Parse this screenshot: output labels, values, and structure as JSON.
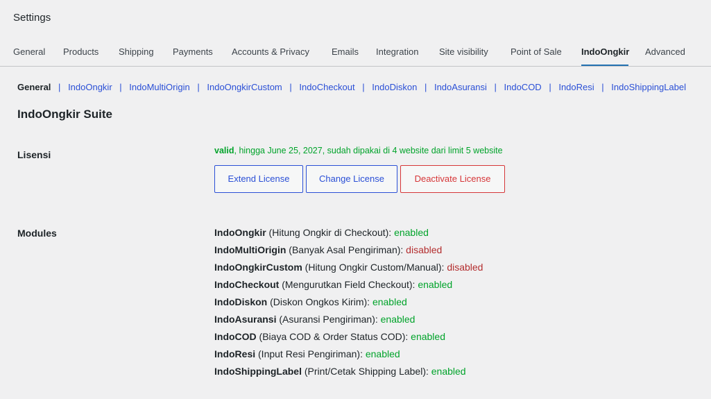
{
  "page": {
    "title": "Settings"
  },
  "tabs": [
    {
      "label": "General"
    },
    {
      "label": "Products"
    },
    {
      "label": "Shipping"
    },
    {
      "label": "Payments"
    },
    {
      "label": "Accounts & Privacy"
    },
    {
      "label": "Emails"
    },
    {
      "label": "Integration"
    },
    {
      "label": "Site visibility"
    },
    {
      "label": "Point of Sale"
    },
    {
      "label": "IndoOngkir",
      "active": true
    },
    {
      "label": "Advanced"
    }
  ],
  "subnav": {
    "separator": "|",
    "items": [
      {
        "label": "General",
        "current": true
      },
      {
        "label": "IndoOngkir"
      },
      {
        "label": "IndoMultiOrigin"
      },
      {
        "label": "IndoOngkirCustom"
      },
      {
        "label": "IndoCheckout"
      },
      {
        "label": "IndoDiskon"
      },
      {
        "label": "IndoAsuransi"
      },
      {
        "label": "IndoCOD"
      },
      {
        "label": "IndoResi"
      },
      {
        "label": "IndoShippingLabel"
      }
    ]
  },
  "section": {
    "title": "IndoOngkir Suite"
  },
  "license": {
    "label": "Lisensi",
    "status_word": "valid",
    "status_detail": ", hingga June 25, 2027, sudah dipakai di 4 website dari limit 5 website",
    "status_color": "#00a32a",
    "buttons": {
      "extend": "Extend License",
      "change": "Change License",
      "deactivate": "Deactivate License"
    }
  },
  "modules": {
    "label": "Modules",
    "items": [
      {
        "name": "IndoOngkir",
        "desc": " (Hitung Ongkir di Checkout): ",
        "status": "enabled"
      },
      {
        "name": "IndoMultiOrigin",
        "desc": " (Banyak Asal Pengiriman): ",
        "status": "disabled"
      },
      {
        "name": "IndoOngkirCustom",
        "desc": " (Hitung Ongkir Custom/Manual): ",
        "status": "disabled"
      },
      {
        "name": "IndoCheckout",
        "desc": " (Mengurutkan Field Checkout): ",
        "status": "enabled"
      },
      {
        "name": "IndoDiskon",
        "desc": " (Diskon Ongkos Kirim): ",
        "status": "enabled"
      },
      {
        "name": "IndoAsuransi",
        "desc": " (Asuransi Pengiriman): ",
        "status": "enabled"
      },
      {
        "name": "IndoCOD",
        "desc": " (Biaya COD & Order Status COD): ",
        "status": "enabled"
      },
      {
        "name": "IndoResi",
        "desc": " (Input Resi Pengiriman): ",
        "status": "enabled"
      },
      {
        "name": "IndoShippingLabel",
        "desc": " (Print/Cetak Shipping Label): ",
        "status": "enabled"
      }
    ]
  },
  "colors": {
    "link": "#2a4fd6",
    "enabled": "#00a32a",
    "disabled": "#b32d2e",
    "danger": "#d63638",
    "tab_underline": "#2271b1"
  }
}
